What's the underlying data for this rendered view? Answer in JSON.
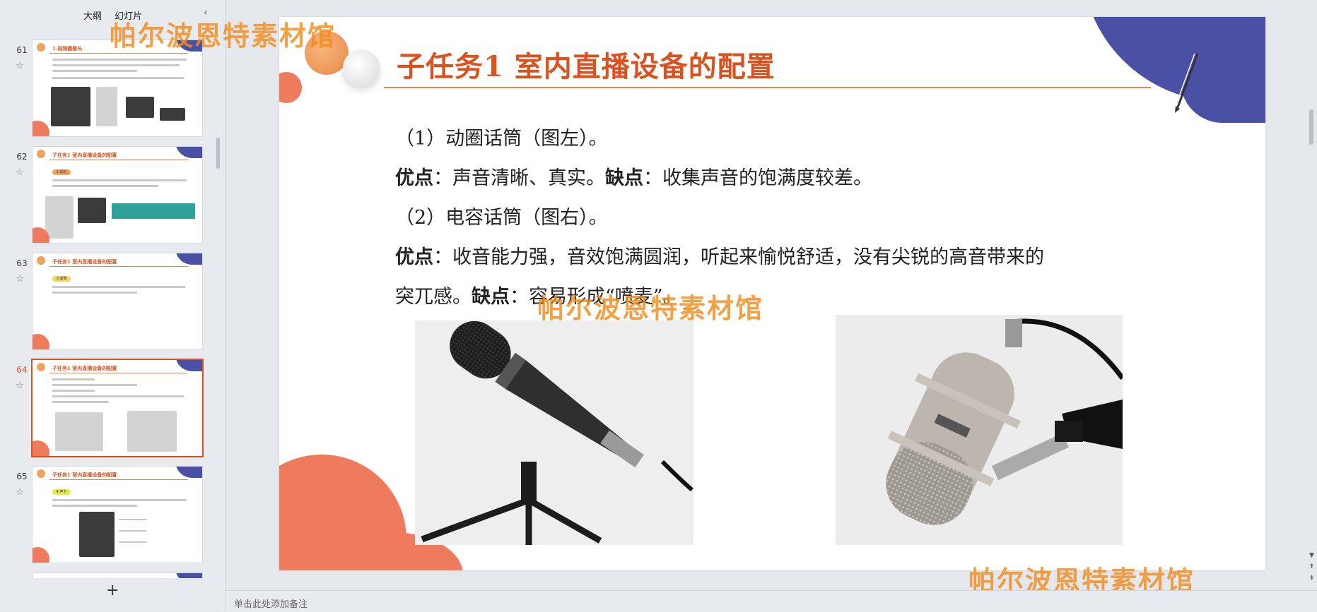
{
  "panel": {
    "tab_outline": "大纲",
    "tab_slides": "幻灯片",
    "collapse": "‹",
    "add_slide": "+"
  },
  "slides": [
    {
      "num": "61",
      "title": "1.视频摄像头",
      "active": false
    },
    {
      "num": "62",
      "title": "子任务1 室内直播设备的配置",
      "tag": "2.耳机",
      "active": false
    },
    {
      "num": "63",
      "title": "子任务1 室内直播设备的配置",
      "tag": "3.话筒",
      "active": false
    },
    {
      "num": "64",
      "title": "子任务1 室内直播设备的配置",
      "active": true
    },
    {
      "num": "65",
      "title": "子任务1 室内直播设备的配置",
      "tag": "4.声卡",
      "active": false
    }
  ],
  "slide": {
    "title": "子任务1 室内直播设备的配置",
    "line1": "（1）动圈话筒（图左）。",
    "line2_label1": "优点",
    "line2_text1": "：声音清晰、真实。",
    "line2_label2": "缺点",
    "line2_text2": "：收集声音的饱满度较差。",
    "line3": "（2）电容话筒（图右）。",
    "line4_label": "优点",
    "line4_text": "：收音能力强，音效饱满圆润，听起来愉悦舒适，没有尖锐的高音带来的",
    "line5_text1": "突兀感。",
    "line5_label": "缺点",
    "line5_text2": "：容易形成“喷麦”。"
  },
  "watermark": "帕尔波恩特素材馆",
  "notes_placeholder": "单击此处添加备注",
  "colors": {
    "accent": "#d9521f",
    "navy": "#4a50a3",
    "coral": "#ee7b5d",
    "watermark": "#f08c1e"
  }
}
